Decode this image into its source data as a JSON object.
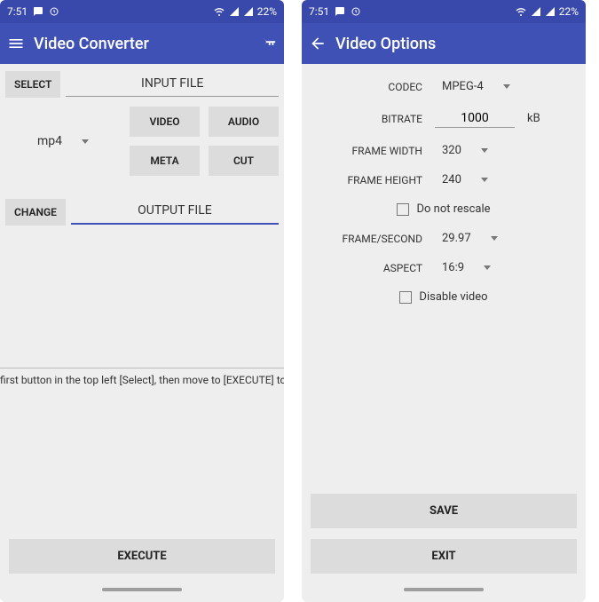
{
  "status": {
    "time": "7:51",
    "battery": "22%"
  },
  "screen1": {
    "title": "Video Converter",
    "select_btn": "SELECT",
    "input_label": "INPUT FILE",
    "format_value": "mp4",
    "btns": {
      "video": "VIDEO",
      "audio": "AUDIO",
      "meta": "META",
      "cut": "CUT"
    },
    "change_btn": "CHANGE",
    "output_label": "OUTPUT FILE",
    "hint": "first button in the top left [Select], then move to [EXECUTE] to star",
    "execute_btn": "EXECUTE"
  },
  "screen2": {
    "title": "Video Options",
    "fields": {
      "codec_label": "CODEC",
      "codec_value": "MPEG-4",
      "bitrate_label": "BITRATE",
      "bitrate_value": "1000",
      "bitrate_unit": "kB",
      "fw_label": "FRAME WIDTH",
      "fw_value": "320",
      "fh_label": "FRAME HEIGHT",
      "fh_value": "240",
      "no_rescale": "Do not rescale",
      "fps_label": "FRAME/SECOND",
      "fps_value": "29.97",
      "aspect_label": "ASPECT",
      "aspect_value": "16:9",
      "disable_video": "Disable video"
    },
    "save_btn": "SAVE",
    "exit_btn": "EXIT"
  }
}
